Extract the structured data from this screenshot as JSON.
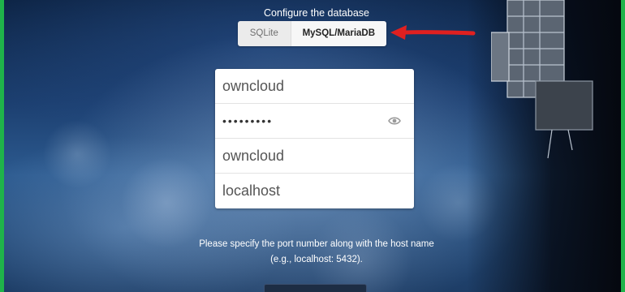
{
  "setup": {
    "title": "Configure the database",
    "db_options": [
      {
        "label": "SQLite",
        "selected": false
      },
      {
        "label": "MySQL/MariaDB",
        "selected": true
      }
    ],
    "fields": {
      "db_user": "owncloud",
      "db_password_masked": "•••••••••",
      "db_name": "owncloud",
      "db_host": "localhost"
    },
    "hint": "Please specify the port number along with the host name (e.g., localhost: 5432)."
  },
  "colors": {
    "window_border": "#1fb34a",
    "annotation_arrow": "#e02020",
    "form_background": "#ffffff"
  },
  "icons": {
    "password_toggle": "eye-icon",
    "annotation": "red-arrow"
  }
}
